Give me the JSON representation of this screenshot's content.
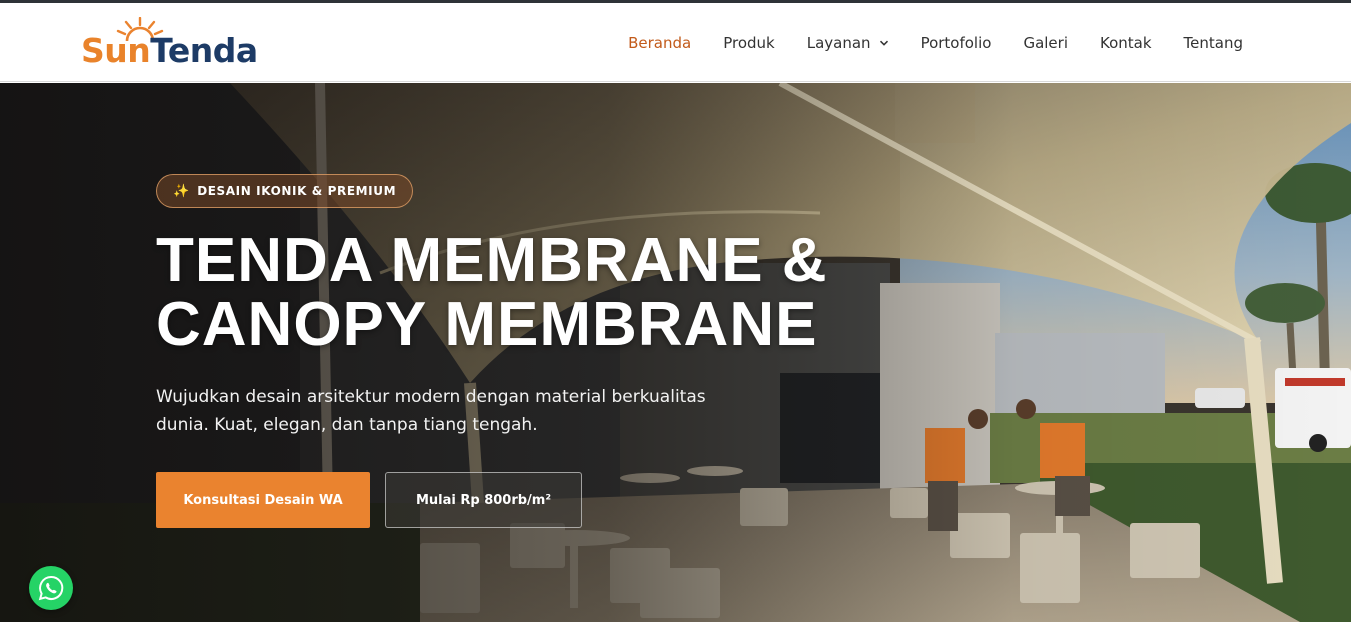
{
  "brand": {
    "logo_sun": "Sun",
    "logo_tenda": "Tenda",
    "colors": {
      "orange": "#ea832f",
      "navy": "#1d3b66",
      "active_nav": "#c25a1a"
    }
  },
  "nav": {
    "items": [
      {
        "label": "Beranda",
        "active": true
      },
      {
        "label": "Produk",
        "active": false
      },
      {
        "label": "Layanan",
        "active": false,
        "has_dropdown": true
      },
      {
        "label": "Portofolio",
        "active": false
      },
      {
        "label": "Galeri",
        "active": false
      },
      {
        "label": "Kontak",
        "active": false
      },
      {
        "label": "Tentang",
        "active": false
      }
    ]
  },
  "hero": {
    "badge_icon": "sparkles-icon",
    "badge": "DESAIN IKONIK & PREMIUM",
    "title_line1": "TENDA MEMBRANE &",
    "title_line2": "CANOPY MEMBRANE",
    "description": "Wujudkan desain arsitektur modern dengan material berkualitas dunia. Kuat, elegan, dan tanpa tiang tengah.",
    "cta_primary": "Konsultasi Desain WA",
    "cta_secondary": "Mulai Rp 800rb/m²"
  },
  "floating": {
    "whatsapp_icon": "whatsapp-icon"
  }
}
